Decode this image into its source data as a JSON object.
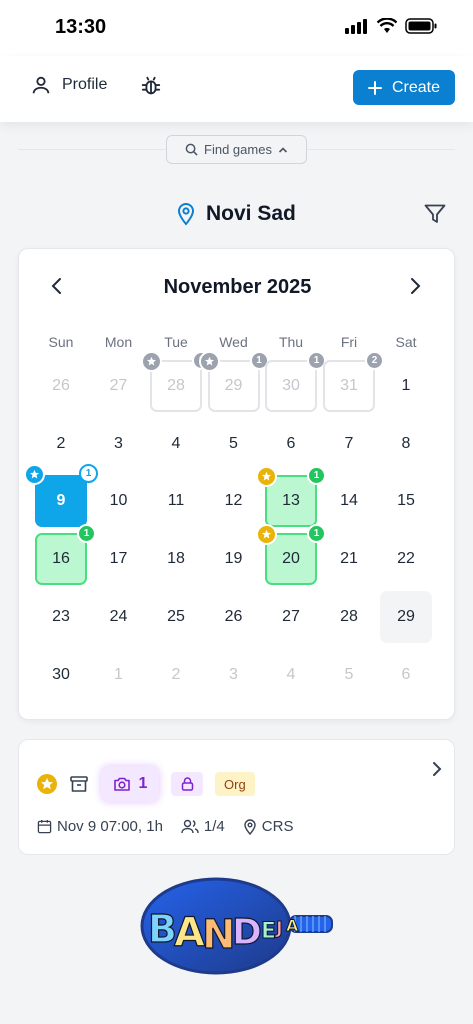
{
  "status": {
    "time": "13:30"
  },
  "topbar": {
    "profile_label": "Profile",
    "create_label": "Create"
  },
  "find": {
    "label": "Find games"
  },
  "location": {
    "name": "Novi Sad"
  },
  "calendar": {
    "month_label": "November 2025",
    "weekdays": [
      "Sun",
      "Mon",
      "Tue",
      "Wed",
      "Thu",
      "Fri",
      "Sat"
    ],
    "weeks": [
      [
        {
          "d": "26",
          "type": "muted"
        },
        {
          "d": "27",
          "type": "muted"
        },
        {
          "d": "28",
          "type": "past-game",
          "count": "1",
          "star": "gray"
        },
        {
          "d": "29",
          "type": "past-game",
          "count": "1",
          "star": "gray"
        },
        {
          "d": "30",
          "type": "past-game",
          "count": "1"
        },
        {
          "d": "31",
          "type": "past-game",
          "count": "2"
        },
        {
          "d": "1",
          "type": "normal"
        }
      ],
      [
        {
          "d": "2",
          "type": "normal"
        },
        {
          "d": "3",
          "type": "normal"
        },
        {
          "d": "4",
          "type": "normal"
        },
        {
          "d": "5",
          "type": "normal"
        },
        {
          "d": "6",
          "type": "normal"
        },
        {
          "d": "7",
          "type": "normal"
        },
        {
          "d": "8",
          "type": "normal"
        }
      ],
      [
        {
          "d": "9",
          "type": "selected",
          "count": "1",
          "star": "blue"
        },
        {
          "d": "10",
          "type": "normal"
        },
        {
          "d": "11",
          "type": "normal"
        },
        {
          "d": "12",
          "type": "normal"
        },
        {
          "d": "13",
          "type": "game",
          "count": "1",
          "star": "gold"
        },
        {
          "d": "14",
          "type": "normal"
        },
        {
          "d": "15",
          "type": "normal"
        }
      ],
      [
        {
          "d": "16",
          "type": "game",
          "count": "1"
        },
        {
          "d": "17",
          "type": "normal"
        },
        {
          "d": "18",
          "type": "normal"
        },
        {
          "d": "19",
          "type": "normal"
        },
        {
          "d": "20",
          "type": "game",
          "count": "1",
          "star": "gold"
        },
        {
          "d": "21",
          "type": "normal"
        },
        {
          "d": "22",
          "type": "normal"
        }
      ],
      [
        {
          "d": "23",
          "type": "normal"
        },
        {
          "d": "24",
          "type": "normal"
        },
        {
          "d": "25",
          "type": "normal"
        },
        {
          "d": "26",
          "type": "normal"
        },
        {
          "d": "27",
          "type": "normal"
        },
        {
          "d": "28",
          "type": "normal"
        },
        {
          "d": "29",
          "type": "today"
        }
      ],
      [
        {
          "d": "30",
          "type": "normal"
        },
        {
          "d": "1",
          "type": "muted"
        },
        {
          "d": "2",
          "type": "muted"
        },
        {
          "d": "3",
          "type": "muted"
        },
        {
          "d": "4",
          "type": "muted"
        },
        {
          "d": "5",
          "type": "muted"
        },
        {
          "d": "6",
          "type": "muted"
        }
      ]
    ]
  },
  "game_card": {
    "photo_count": "1",
    "org_label": "Org",
    "date_label": "Nov 9 07:00, 1h",
    "players_label": "1/4",
    "venue_label": "CRS"
  },
  "logo": {
    "text": "BANDEJA"
  },
  "colors": {
    "primary": "#0b7fd0",
    "selected": "#0ea5e9",
    "game_green": "#bbf7d0",
    "gold": "#eab308"
  }
}
